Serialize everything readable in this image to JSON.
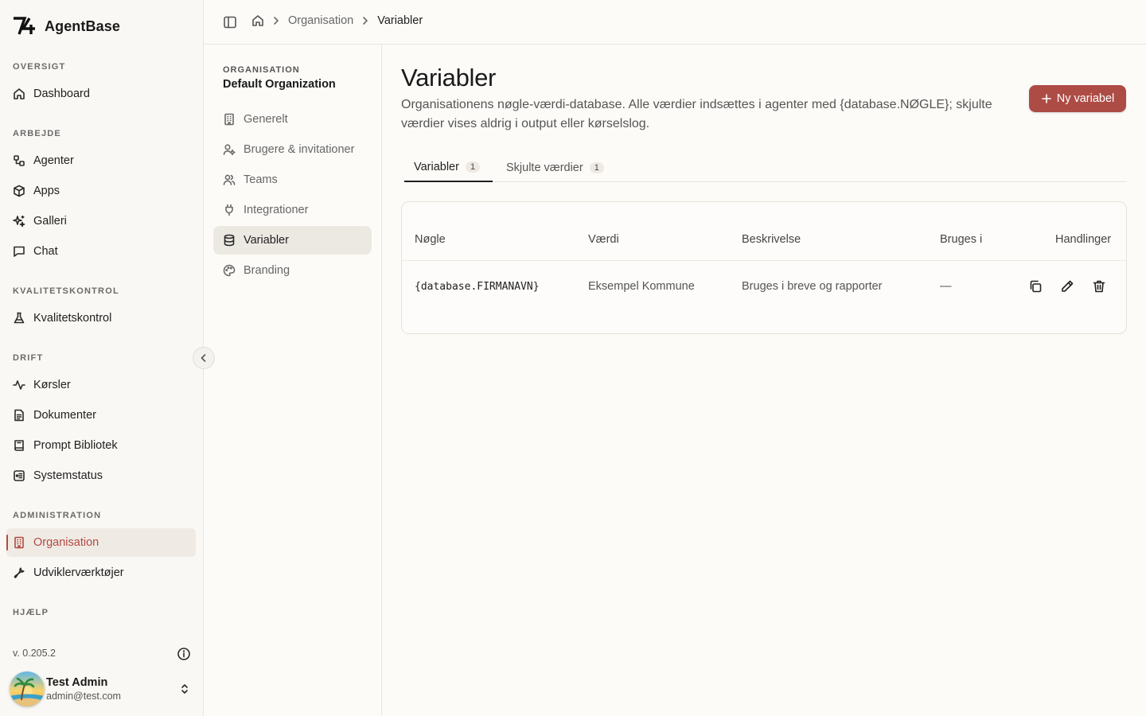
{
  "app": {
    "name": "AgentBase"
  },
  "sidebar": {
    "sections": {
      "oversigt": "OVERSIGT",
      "arbejde": "ARBEJDE",
      "kvalitet": "KVALITETSKONTROL",
      "drift": "DRIFT",
      "admin": "ADMINISTRATION",
      "hjaelp": "HJÆLP"
    },
    "items": {
      "dashboard": "Dashboard",
      "agenter": "Agenter",
      "apps": "Apps",
      "galleri": "Galleri",
      "chat": "Chat",
      "kvalitetskontrol": "Kvalitetskontrol",
      "korsler": "Kørsler",
      "dokumenter": "Dokumenter",
      "prompt": "Prompt Bibliotek",
      "systemstatus": "Systemstatus",
      "organisation": "Organisation",
      "udvikler": "Udviklerværktøjer"
    },
    "version": "v. 0.205.2",
    "user": {
      "name": "Test Admin",
      "email": "admin@test.com"
    }
  },
  "breadcrumb": {
    "parent": "Organisation",
    "current": "Variabler"
  },
  "subnav": {
    "org_label": "ORGANISATION",
    "org_name": "Default Organization",
    "items": {
      "generelt": "Generelt",
      "brugere": "Brugere & invitationer",
      "teams": "Teams",
      "integrationer": "Integrationer",
      "variabler": "Variabler",
      "branding": "Branding"
    }
  },
  "main": {
    "title": "Variabler",
    "description": "Organisationens nøgle-værdi-database. Alle værdier indsættes i agenter med {database.NØGLE}; skjulte værdier vises aldrig i output eller kørselslog.",
    "new_button": "Ny variabel",
    "tabs": [
      {
        "label": "Variabler",
        "count": "1"
      },
      {
        "label": "Skjulte værdier",
        "count": "1"
      }
    ],
    "table": {
      "headers": {
        "key": "Nøgle",
        "value": "Værdi",
        "description": "Beskrivelse",
        "used_in": "Bruges i",
        "actions": "Handlinger"
      },
      "rows": [
        {
          "key": "{database.FIRMANAVN}",
          "value": "Eksempel Kommune",
          "description": "Bruges i breve og rapporter",
          "used_in": "—"
        }
      ]
    }
  },
  "colors": {
    "accent": "#ad4c45",
    "active_text": "#b24a42"
  }
}
